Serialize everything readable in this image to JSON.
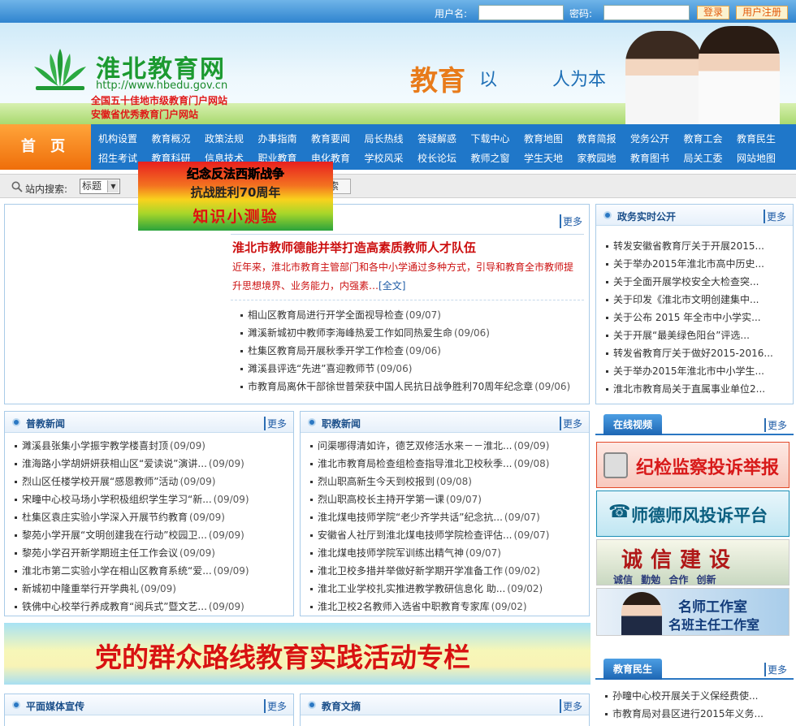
{
  "topbar": {
    "username_label": "用户名:",
    "password_label": "密码:",
    "login": "登录",
    "register": "用户注册"
  },
  "banner": {
    "site_title": "淮北教育网",
    "url": "http://www.hbedu.gov.cn",
    "honor1": "全国五十佳地市级教育门户网站",
    "honor2": "安徽省优秀教育门户网站",
    "slogan_a": "教育",
    "slogan_b": "以",
    "slogan_c": "人为本"
  },
  "nav": {
    "home": "首 页",
    "row1": [
      "机构设置",
      "教育概况",
      "政策法规",
      "办事指南",
      "教育要闻",
      "局长热线",
      "答疑解惑",
      "下载中心",
      "教育地图",
      "教育简报",
      "党务公开",
      "教育工会",
      "教育民生"
    ],
    "row2": [
      "招生考试",
      "教育科研",
      "信息技术",
      "职业教育",
      "电化教育",
      "学校风采",
      "校长论坛",
      "教师之窗",
      "学生天地",
      "家教园地",
      "教育图书",
      "局关工委",
      "网站地图"
    ]
  },
  "search": {
    "label": "站内搜索:",
    "select": "标题",
    "button": "搜索"
  },
  "quiz": {
    "line1": "纪念反法西斯战争",
    "line2": "抗战胜利70周年",
    "line3": "知识小测验"
  },
  "headline": {
    "title": "淮北市教师德能并举打造高素质教师人才队伍",
    "summary": "近年来，淮北市教育主管部门和各中小学通过多种方式，引导和教育全市教师提升思想境界、业务能力，内强素…",
    "full": "[全文]",
    "more": "更多",
    "items": [
      {
        "t": "相山区教育局进行开学全面视导检查",
        "d": "(09/07)"
      },
      {
        "t": "濉溪新城初中教师李海峰热爱工作如同热爱生命",
        "d": "(09/06)"
      },
      {
        "t": "杜集区教育局开展秋季开学工作检查",
        "d": "(09/06)"
      },
      {
        "t": "濉溪县评选“先进”喜迎教师节",
        "d": "(09/06)"
      },
      {
        "t": "市教育局离休干部徐世普荣获中国人民抗日战争胜利70周年纪念章",
        "d": "(09/06)"
      }
    ]
  },
  "gov": {
    "title": "政务实时公开",
    "more": "更多",
    "items": [
      "转发安徽省教育厅关于开展2015...",
      "关于举办2015年淮北市高中历史...",
      "关于全面开展学校安全大检查突...",
      "关于印发《淮北市文明创建集中...",
      "关于公布 2015 年全市中小学实...",
      "关于开展“最美绿色阳台”评选...",
      "转发省教育厅关于做好2015-2016...",
      "关于举办2015年淮北市中小学生...",
      "淮北市教育局关于直属事业单位2..."
    ]
  },
  "puj": {
    "title": "普教新闻",
    "more": "更多",
    "items": [
      {
        "t": "濉溪县张集小学振宇教学楼喜封顶",
        "d": "(09/09)"
      },
      {
        "t": "淮海路小学胡妍妍获相山区“爱读说”演讲...",
        "d": "(09/09)"
      },
      {
        "t": "烈山区任楼学校开展“感恩教师”活动",
        "d": "(09/09)"
      },
      {
        "t": "宋疃中心校马场小学积极组织学生学习“新...",
        "d": "(09/09)"
      },
      {
        "t": "杜集区袁庄实验小学深入开展节约教育",
        "d": "(09/09)"
      },
      {
        "t": "黎苑小学开展“文明创建我在行动”校园卫...",
        "d": "(09/09)"
      },
      {
        "t": "黎苑小学召开新学期班主任工作会议",
        "d": "(09/09)"
      },
      {
        "t": "淮北市第二实验小学在相山区教育系统“爱...",
        "d": "(09/09)"
      },
      {
        "t": "新城初中隆重举行开学典礼",
        "d": "(09/09)"
      },
      {
        "t": "铁佛中心校举行养成教育“阅兵式”暨文艺...",
        "d": "(09/09)"
      }
    ]
  },
  "zhij": {
    "title": "职教新闻",
    "more": "更多",
    "items": [
      {
        "t": "问渠哪得清如许，德艺双修活水来－－淮北...",
        "d": "(09/09)"
      },
      {
        "t": "淮北市教育局检查组检查指导淮北卫校秋季...",
        "d": "(09/08)"
      },
      {
        "t": "烈山职高新生今天到校报到",
        "d": "(09/08)"
      },
      {
        "t": "烈山职高校长主持开学第一课",
        "d": "(09/07)"
      },
      {
        "t": "淮北煤电技师学院“老少齐学共话”纪念抗...",
        "d": "(09/07)"
      },
      {
        "t": "安徽省人社厅到淮北煤电技师学院检查评估...",
        "d": "(09/07)"
      },
      {
        "t": "淮北煤电技师学院军训练出精气神",
        "d": "(09/07)"
      },
      {
        "t": "淮北卫校多措并举做好新学期开学准备工作",
        "d": "(09/02)"
      },
      {
        "t": "淮北工业学校扎实推进教学教研信息化 助...",
        "d": "(09/02)"
      },
      {
        "t": "淮北卫校2名教师入选省中职教育专家库",
        "d": "(09/02)"
      }
    ]
  },
  "video": {
    "title": "在线视频",
    "more": "更多"
  },
  "ads": {
    "a1": "纪检监察投诉举报",
    "a2": "师德师风投诉平台",
    "a3": "诚信建设",
    "a3sub": "诚信 勤勉 合作 创新",
    "a4a": "名师工作室",
    "a4b": "名班主任工作室"
  },
  "party_banner": "党的群众路线教育实践活动专栏",
  "minsheng": {
    "title": "教育民生",
    "more": "更多",
    "items": [
      "孙疃中心校开展关于义保经费使...",
      "市教育局对县区进行2015年义务..."
    ]
  },
  "media": {
    "title": "平面媒体宣传",
    "more": "更多"
  },
  "wenzhai": {
    "title": "教育文摘",
    "more": "更多"
  }
}
